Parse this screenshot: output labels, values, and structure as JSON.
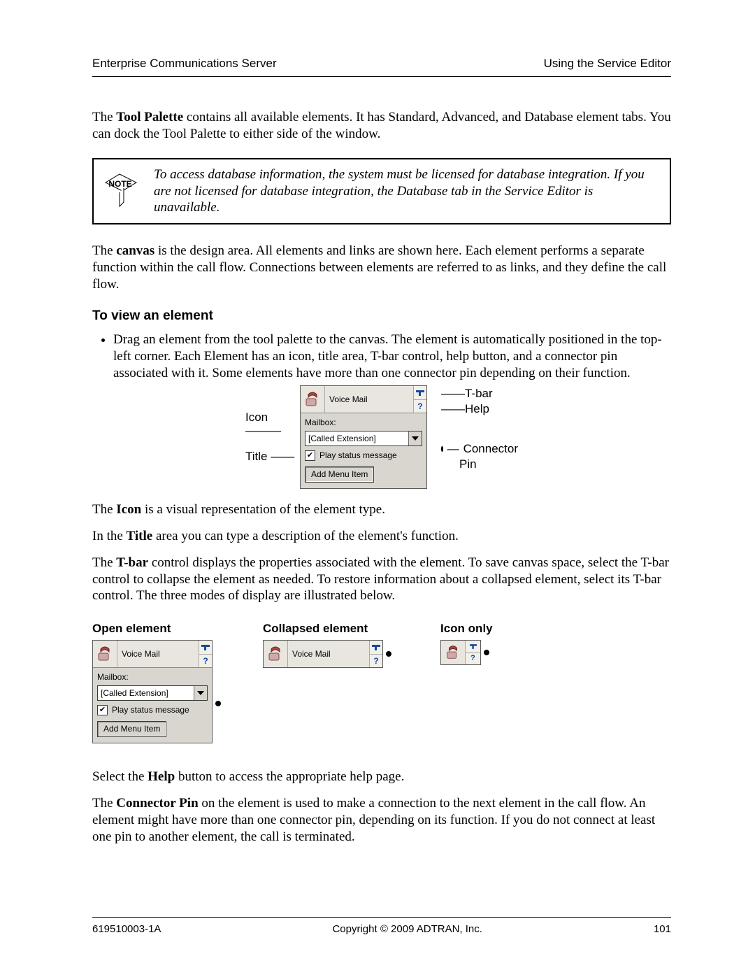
{
  "header": {
    "left": "Enterprise Communications Server",
    "right": "Using the Service Editor"
  },
  "para1_pre": "The ",
  "para1_bold": "Tool Palette",
  "para1_post": " contains all available elements. It has Standard, Advanced, and Database element tabs. You can dock the Tool Palette to either side of the window.",
  "note_label": "NOTE",
  "note_text": "To access database information, the system must be licensed for database integration. If you are not licensed for database integration, the Database tab in the Service Editor is unavailable.",
  "para2_pre": "The ",
  "para2_bold": "canvas",
  "para2_post": " is the design area. All elements and links are shown here. Each element performs a separate function within the call flow. Connections between elements are referred to as links, and they define the call flow.",
  "subhead_view": "To view an element",
  "bullet_view": "Drag an element from the tool palette to the canvas. The element is automatically positioned in the top-left corner. Each Element has an icon, title area, T-bar control, help button, and a connector pin associated with it. Some elements have more than one connector pin depending on their function.",
  "anatomy": {
    "left_icon": "Icon",
    "left_title": "Title",
    "right_tbar": "T-bar",
    "right_help": "Help",
    "right_conn1": "Connector",
    "right_conn2": "Pin"
  },
  "element": {
    "title": "Voice Mail",
    "label": "Mailbox:",
    "select_value": "[Called Extension]",
    "check_label": "Play status message",
    "button_label": "Add Menu Item",
    "help_glyph": "?"
  },
  "para_icon_pre": "The ",
  "para_icon_bold": "Icon",
  "para_icon_post": " is a visual representation of the element type.",
  "para_title_pre": "In the ",
  "para_title_bold": "Title",
  "para_title_post": " area you can type a description of the element's function.",
  "para_tbar_pre": "The ",
  "para_tbar_bold": "T-bar",
  "para_tbar_post": " control displays the properties associated with the element. To save canvas space, select the T-bar control to collapse the element as needed. To restore information about a collapsed element, select its T-bar control. The three modes of display are illustrated below.",
  "modes": {
    "open": "Open element",
    "collapsed": "Collapsed element",
    "icon": "Icon only"
  },
  "para_help_pre": "Select the ",
  "para_help_bold": "Help",
  "para_help_post": " button to access the appropriate help page.",
  "para_conn_pre": "The ",
  "para_conn_bold": "Connector Pin",
  "para_conn_post": " on the element is used to make a connection to the next element in the call flow. An element might have more than one connector pin, depending on its function. If you do not connect at least one pin to another element, the call is terminated.",
  "footer": {
    "left": "619510003-1A",
    "center": "Copyright © 2009 ADTRAN, Inc.",
    "right": "101"
  }
}
